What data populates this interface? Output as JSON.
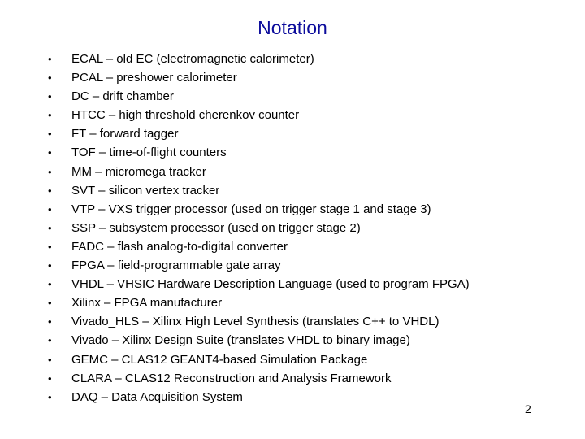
{
  "slide": {
    "title": "Notation",
    "title_color": "#0c0c9c",
    "bullet_glyph": "•",
    "items": [
      {
        "text": "ECAL – old EC (electromagnetic calorimeter)"
      },
      {
        "text": "PCAL – preshower calorimeter"
      },
      {
        "text": "DC – drift chamber"
      },
      {
        "text": "HTCC – high threshold cherenkov counter"
      },
      {
        "text": "FT – forward tagger"
      },
      {
        "text": "TOF – time-of-flight counters"
      },
      {
        "text": "MM – micromega tracker"
      },
      {
        "text": "SVT – silicon vertex tracker"
      },
      {
        "text": "VTP – VXS trigger processor (used on trigger stage 1 and stage 3)"
      },
      {
        "text": "SSP – subsystem processor (used on trigger stage 2)"
      },
      {
        "text": "FADC – flash analog-to-digital converter"
      },
      {
        "text": "FPGA – field-programmable gate array"
      },
      {
        "text": "VHDL – VHSIC Hardware Description Language (used to program FPGA)"
      },
      {
        "text": "Xilinx – FPGA manufacturer"
      },
      {
        "text": "Vivado_HLS – Xilinx High Level Synthesis (translates C++ to VHDL)"
      },
      {
        "text": "Vivado – Xilinx Design Suite (translates VHDL to binary image)"
      },
      {
        "text": "GEMC – CLAS12 GEANT4-based Simulation Package"
      },
      {
        "text": "CLARA – CLAS12 Reconstruction and Analysis Framework"
      },
      {
        "text": "DAQ – Data Acquisition System"
      }
    ],
    "page_number": "2"
  }
}
